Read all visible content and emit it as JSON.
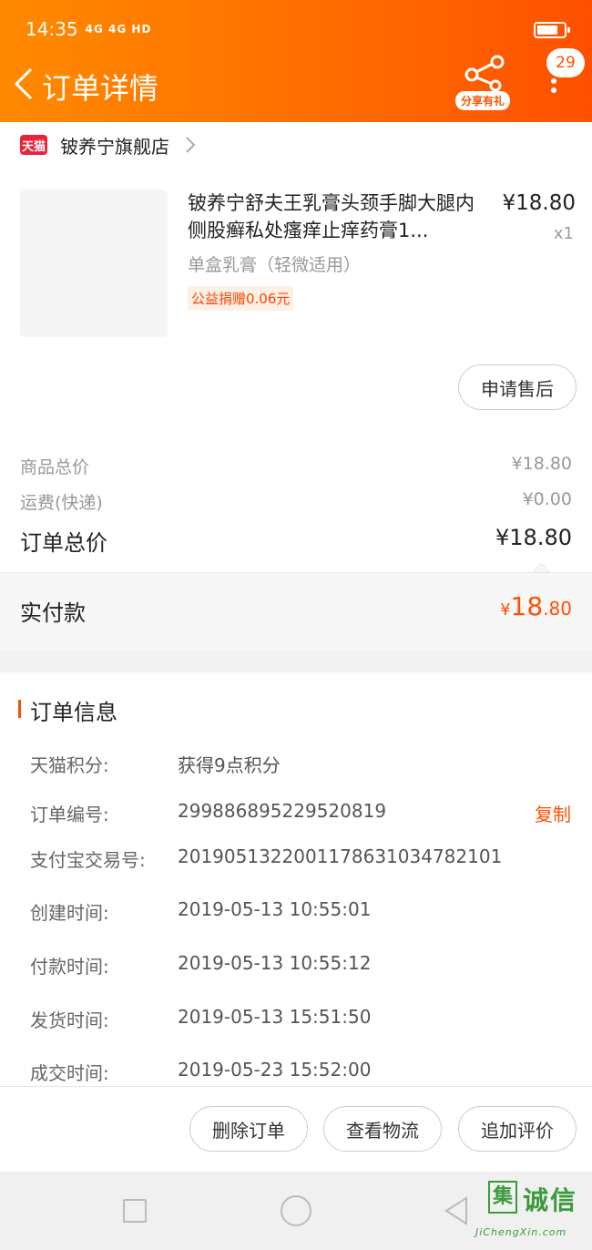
{
  "status_bar": {
    "time": "14:35",
    "signal": "4G 4G HD"
  },
  "header": {
    "title": "订单详情",
    "share_label": "分享有礼",
    "badge_count": "29"
  },
  "store": {
    "logo_text": "天猫",
    "name": "铍养宁旗舰店"
  },
  "product": {
    "title": "铍养宁舒夫王乳膏头颈手脚大腿内侧股癣私处瘙痒止痒药膏1...",
    "price": "¥18.80",
    "quantity": "x1",
    "spec": "单盒乳膏（轻微适用）",
    "charity": "公益捐赠0.06元"
  },
  "buttons": {
    "after_sale": "申请售后",
    "delete_order": "删除订单",
    "view_logistics": "查看物流",
    "add_review": "追加评价"
  },
  "price_summary": {
    "goods_label": "商品总价",
    "goods_value": "¥18.80",
    "shipping_label": "运费(快递)",
    "shipping_value": "¥0.00",
    "total_label": "订单总价",
    "total_value": "¥18.80"
  },
  "paid": {
    "label": "实付款",
    "currency": "¥",
    "integer": "18",
    "decimal": ".80"
  },
  "order_info": {
    "title": "订单信息",
    "copy_label": "复制",
    "rows": [
      {
        "key": "天猫积分:",
        "value": "获得9点积分"
      },
      {
        "key": "订单编号:",
        "value": "299886895229520819"
      },
      {
        "key": "支付宝交易号:",
        "value": "2019051322001178631034782101"
      },
      {
        "key": "创建时间:",
        "value": "2019-05-13 10:55:01"
      },
      {
        "key": "付款时间:",
        "value": "2019-05-13 10:55:12"
      },
      {
        "key": "发货时间:",
        "value": "2019-05-13 15:51:50"
      },
      {
        "key": "成交时间:",
        "value": "2019-05-23 15:52:00"
      }
    ]
  },
  "watermark": {
    "logo": "集",
    "text": "诚信",
    "url": "JiChengXin.com"
  },
  "colors": {
    "accent": "#ff5000",
    "header_start": "#ff8a00",
    "tmall_red": "#e8233a"
  }
}
